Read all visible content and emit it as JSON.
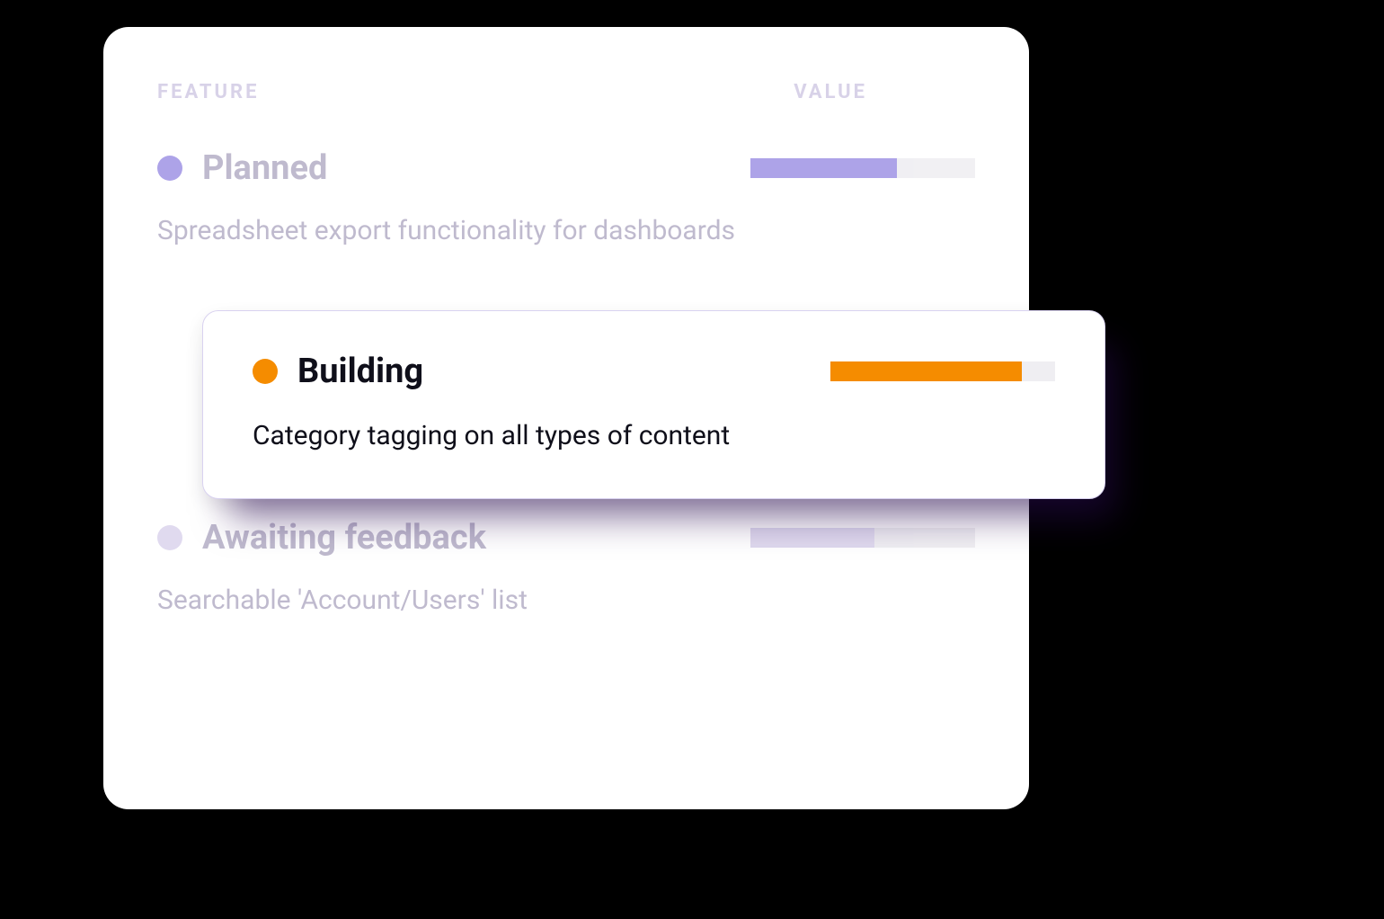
{
  "headers": {
    "feature": "FEATURE",
    "value": "VALUE"
  },
  "rows": [
    {
      "status": "Planned",
      "description": "Spreadsheet export functionality for dashboards",
      "dot_color": "#a59ae6",
      "bar_color": "#a59ae6",
      "progress": 65
    },
    {
      "status": "Building",
      "description": "Category tagging on all types of content",
      "dot_color": "#f58c00",
      "bar_color": "#f58c00",
      "progress": 85,
      "highlighted": true
    },
    {
      "status": "Awaiting feedback",
      "description": "Searchable 'Account/Users' list",
      "dot_color": "#ddd7ee",
      "bar_color": "#ddd7ee",
      "progress": 55
    }
  ]
}
